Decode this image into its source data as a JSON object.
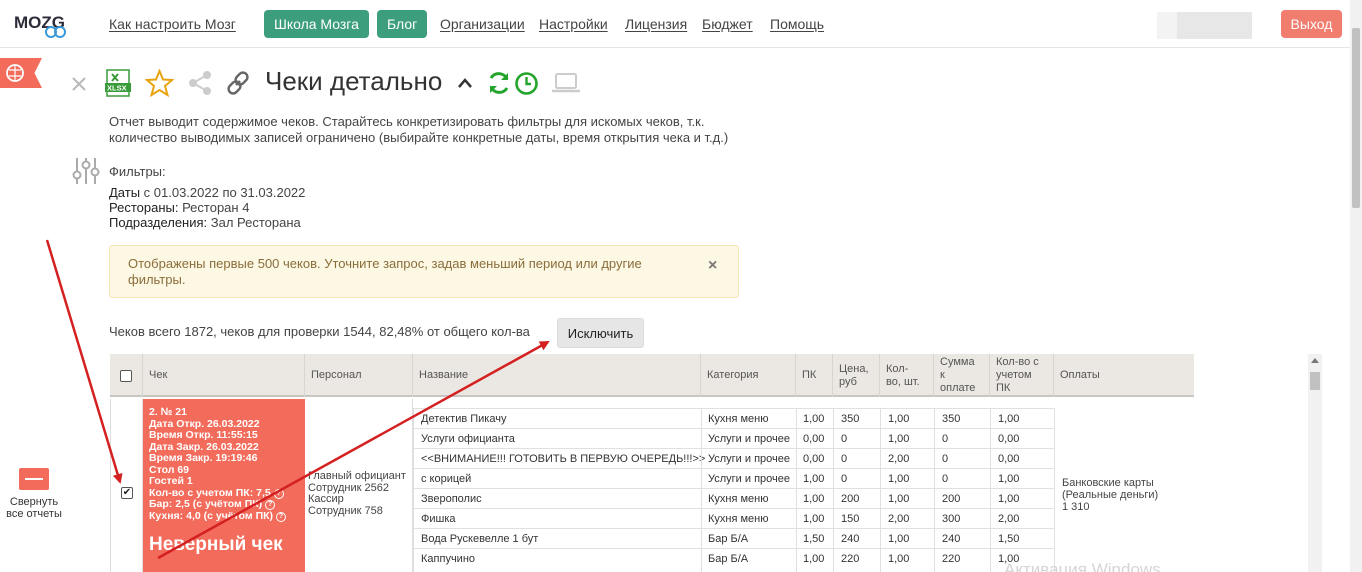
{
  "nav": {
    "logo": "MOZG",
    "links": [
      "Как настроить Мозг",
      "Организации",
      "Настройки",
      "Лицензия",
      "Бюджет",
      "Помощь"
    ],
    "school_btn": "Школа Мозга",
    "blog_btn": "Блог",
    "exit_btn": "Выход"
  },
  "report": {
    "title": "Чеки детально",
    "xlsx_label": "XLSX",
    "description": "Отчет выводит содержимое чеков. Старайтесь конкретизировать фильтры для искомых чеков, т.к. количество выводимых записей ограничено (выбирайте конкретные даты, время открытия чека и т.д.)"
  },
  "filters": {
    "label": "Фильтры:",
    "dates_key": "Даты",
    "dates_val": " с 01.03.2022 по 31.03.2022",
    "rest_key": "Рестораны:",
    "rest_val": " Ресторан 4",
    "dept_key": "Подразделения:",
    "dept_val": " Зал Ресторана"
  },
  "alert": {
    "text": "Отображены первые 500 чеков. Уточните запрос, задав меньший период или другие фильтры.",
    "close": "×"
  },
  "summary": {
    "totals": "Чеков всего 1872, чеков для проверки 1544, 82,48% от общего кол-ва",
    "exclude_btn": "Исключить"
  },
  "sidebar": {
    "collapse_all": "Свернуть все отчеты"
  },
  "table": {
    "headers": [
      "Чек",
      "Персонал",
      "Название",
      "Категория",
      "ПК",
      "Цена, руб",
      "Кол-во, шт.",
      "Сумма к оплате",
      "Кол-во с учетом ПК",
      "Оплаты"
    ],
    "receipt": {
      "number": "2. № 21",
      "opened_date": "Дата Откр. 26.03.2022",
      "opened_time": "Время Откр. 11:55:15",
      "closed_date": "Дата Закр. 26.03.2022",
      "closed_time": "Время Закр. 19:19:46",
      "table": "Стол 69",
      "guests": "Гостей 1",
      "qty_pk": "Кол-во с учетом ПК: 7,5",
      "bar": "Бар: 2,5 (с учётом ПК)",
      "kitchen": "Кухня: 4,0 (с учётом ПК)",
      "status": "Неверный чек",
      "help": "?"
    },
    "staff": {
      "role1": "Главный официант",
      "name1": "Сотрудник 2562",
      "role2": "Кассир",
      "name2": "Сотрудник 758"
    },
    "items": [
      {
        "name": "Детектив Пикачу",
        "category": "Кухня меню",
        "pk": "1,00",
        "price": "350",
        "qty": "1,00",
        "sum": "350",
        "qty_pk": "1,00"
      },
      {
        "name": "Услуги официанта",
        "category": "Услуги и прочее",
        "pk": "0,00",
        "price": "0",
        "qty": "1,00",
        "sum": "0",
        "qty_pk": "0,00"
      },
      {
        "name": "<<ВНИМАНИЕ!!! ГОТОВИТЬ В ПЕРВУЮ ОЧЕРЕДЬ!!!>>",
        "category": "Услуги и прочее",
        "pk": "0,00",
        "price": "0",
        "qty": "2,00",
        "sum": "0",
        "qty_pk": "0,00"
      },
      {
        "name": "с корицей",
        "category": "Услуги и прочее",
        "pk": "1,00",
        "price": "0",
        "qty": "1,00",
        "sum": "0",
        "qty_pk": "1,00"
      },
      {
        "name": "Зверополис",
        "category": "Кухня меню",
        "pk": "1,00",
        "price": "200",
        "qty": "1,00",
        "sum": "200",
        "qty_pk": "1,00"
      },
      {
        "name": "Фишка",
        "category": "Кухня меню",
        "pk": "1,00",
        "price": "150",
        "qty": "2,00",
        "sum": "300",
        "qty_pk": "2,00"
      },
      {
        "name": "Вода Рускевелле 1 бут",
        "category": "Бар Б/А",
        "pk": "1,50",
        "price": "240",
        "qty": "1,00",
        "sum": "240",
        "qty_pk": "1,50"
      },
      {
        "name": "Каппучино",
        "category": "Бар Б/А",
        "pk": "1,00",
        "price": "220",
        "qty": "1,00",
        "sum": "220",
        "qty_pk": "1,00"
      }
    ],
    "payments": {
      "line1": "Банковские карты",
      "line2": "(Реальные деньги)",
      "line3": "1 310"
    },
    "row_checked": "✔"
  },
  "watermark": "Активация Windows",
  "colors": {
    "accent_green": "#3d9e7d",
    "exit_red": "#f07d6e",
    "receipt_red": "#f26b5b",
    "alert_bg": "#fcf8e3",
    "annotation_arrow": "#d42020"
  }
}
